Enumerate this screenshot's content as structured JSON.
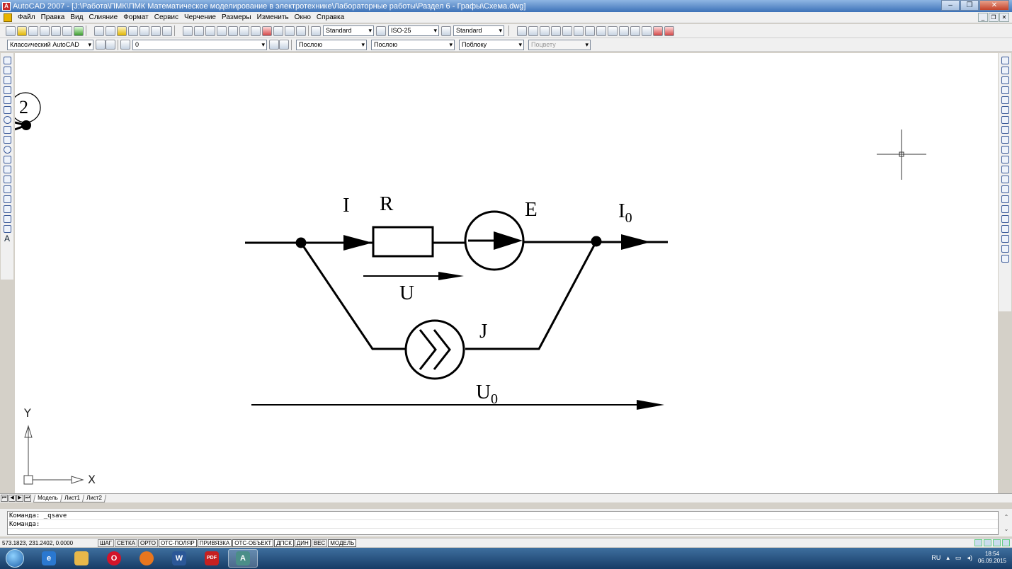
{
  "window": {
    "title": "AutoCAD 2007 - [J:\\Работа\\ПМК\\ПМК Математическое моделирование в электротехнике\\Лабораторные работы\\Раздел 6 - Графы\\Схема.dwg]"
  },
  "menu": [
    "Файл",
    "Правка",
    "Вид",
    "Слияние",
    "Формат",
    "Сервис",
    "Черчение",
    "Размеры",
    "Изменить",
    "Окно",
    "Справка"
  ],
  "toolbar": {
    "text_style": "Standard",
    "dim_style": "ISO-25",
    "table_style": "Standard",
    "workspace": "Классический AutoCAD",
    "layer": "0",
    "color": "Послою",
    "linetype": "Послою",
    "lineweight": "Поблоку",
    "plotstyle": "Поцвету"
  },
  "drawing": {
    "node_number": "2",
    "labels": {
      "I": "I",
      "R": "R",
      "E": "E",
      "I0_base": "I",
      "I0_sub": "0",
      "U": "U",
      "J": "J",
      "U0_base": "U",
      "U0_sub": "0"
    },
    "ucs_x": "X",
    "ucs_y": "Y"
  },
  "tabs": [
    "Модель",
    "Лист1",
    "Лист2"
  ],
  "command": {
    "line1": "Команда:  _qsave",
    "line2": "Команда:"
  },
  "status": {
    "coords": "573.1823, 231.2402, 0.0000",
    "buttons": [
      "ШАГ",
      "СЕТКА",
      "ОРТО",
      "ОТС-ПОЛЯР",
      "ПРИВЯЗКА",
      "ОТС-ОБЪЕКТ",
      "ДПСК",
      "ДИН",
      "ВЕС",
      "МОДЕЛЬ"
    ]
  },
  "taskbar": {
    "lang": "RU",
    "time": "18:54",
    "date": "06.09.2015"
  },
  "colors": {
    "canvas": "#ffffff",
    "ink": "#000000",
    "titlebar": "#3d72b8"
  }
}
